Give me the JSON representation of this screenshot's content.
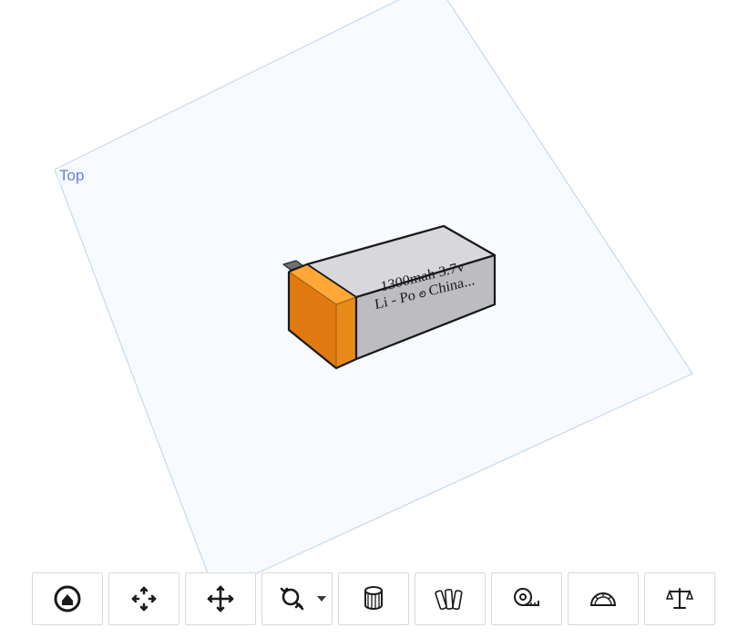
{
  "viewport": {
    "plane_label": "Top",
    "model": {
      "label_line1": "1300mah 3.7v",
      "label_line2_left": "Li - Po",
      "label_line2_right": "China..."
    }
  },
  "toolbar": {
    "items": [
      {
        "id": "home",
        "label": "Home view",
        "icon": "home-icon"
      },
      {
        "id": "fit",
        "label": "Fit",
        "icon": "fit-icon"
      },
      {
        "id": "pan",
        "label": "Pan",
        "icon": "pan-icon"
      },
      {
        "id": "zoom",
        "label": "Zoom",
        "icon": "zoom-icon",
        "has_caret": true
      },
      {
        "id": "section",
        "label": "Section view",
        "icon": "section-icon"
      },
      {
        "id": "appearance",
        "label": "Appearance",
        "icon": "swatch-icon"
      },
      {
        "id": "measure",
        "label": "Measure",
        "icon": "tape-icon"
      },
      {
        "id": "angle",
        "label": "Protractor",
        "icon": "protractor-icon"
      },
      {
        "id": "mass",
        "label": "Mass properties",
        "icon": "scale-icon"
      }
    ]
  }
}
